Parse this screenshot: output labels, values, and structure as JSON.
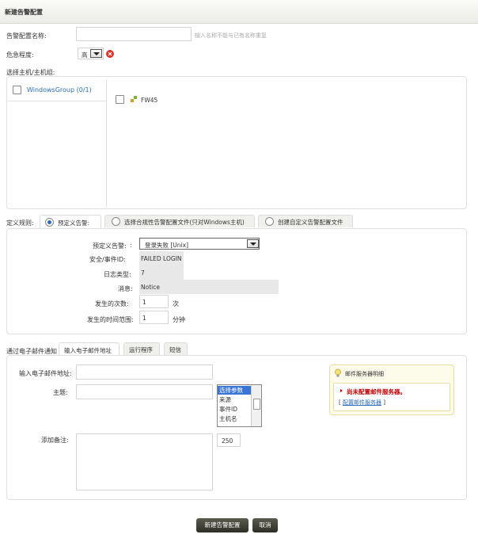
{
  "page_title": "新建告警配置",
  "form": {
    "name_label": "告警配置名称:",
    "name_value": "",
    "name_hint": "输入名称不能与已有名称重复",
    "severity_label": "危急程度:",
    "severity_value": "高",
    "select_hosts_label": "选择主机/主机组:",
    "host_groups": [
      {
        "label": "WindowsGroup (0/1)"
      }
    ],
    "hosts": [
      {
        "label": "FW45"
      }
    ]
  },
  "definition": {
    "rule_label": "定义规则:",
    "tabs": [
      {
        "label": "预定义告警:"
      },
      {
        "label": "选择合规性告警配置文件(只对Windows主机)"
      },
      {
        "label": "创建自定义告警配置文件"
      }
    ],
    "predefined_label": "预定义告警:",
    "predefined_value": "登录失败 [Unix]",
    "event_id_label": "安全/事件ID:",
    "event_id_value": "FAILED LOGIN",
    "log_type_label": "日志类型:",
    "log_type_value": "7",
    "message_label": "消息:",
    "message_value": "Notice",
    "count_label": "发生的次数:",
    "count_value": "1",
    "count_unit": "次",
    "range_label": "发生的时间范围:",
    "range_value": "1",
    "range_unit": "分钟"
  },
  "notify": {
    "label": "通过电子邮件通知",
    "tabs": [
      {
        "label": "输入电子邮件地址"
      },
      {
        "label": "运行程序"
      },
      {
        "label": "短信"
      }
    ],
    "email_label": "输入电子邮件地址:",
    "email_value": "",
    "subject_label": "主题:",
    "subject_value": "",
    "params": [
      "选择参数",
      "来源",
      "事件ID",
      "主机名"
    ],
    "body_label": "添加备注:",
    "body_value": "",
    "char_count": "250",
    "mail_server": {
      "title": "邮件服务器明细",
      "warning": "尚未配置邮件服务器。",
      "link": "配置邮件服务器"
    }
  },
  "buttons": {
    "submit": "新建告警配置",
    "cancel": "取消"
  },
  "colors": {
    "accent_blue": "#2a6db5",
    "warning_red": "#c00000",
    "button_dark": "#3a3a32"
  }
}
